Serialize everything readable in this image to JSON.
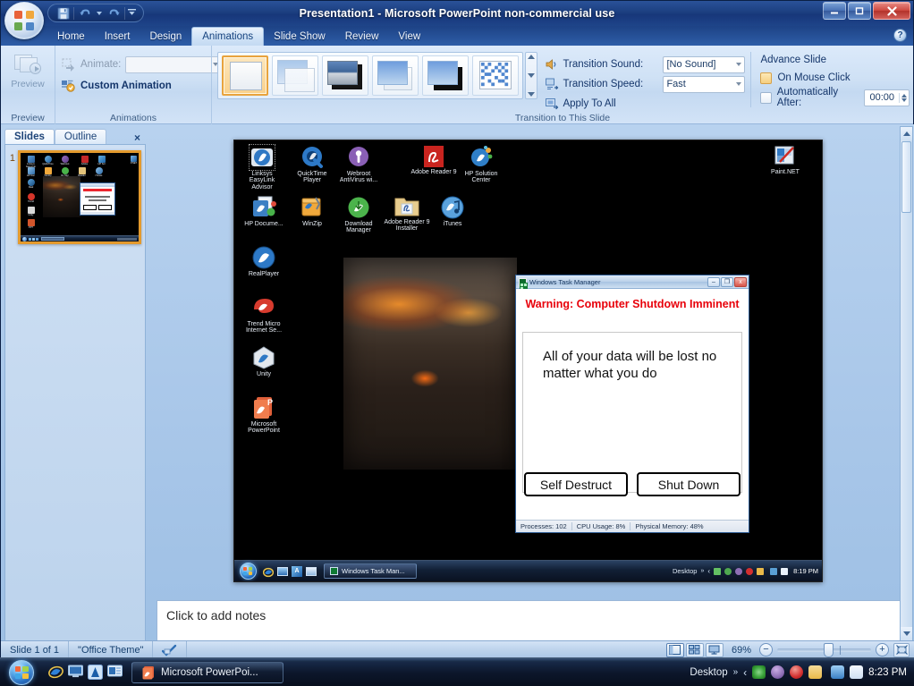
{
  "window": {
    "title": "Presentation1 - Microsoft PowerPoint non-commercial use",
    "minimize_label": "–",
    "restore_label": "❐",
    "close_label": "✕",
    "help_label": "?"
  },
  "quick_access": [
    {
      "name": "save-icon",
      "label": "Save"
    },
    {
      "name": "undo-icon",
      "label": "Undo"
    },
    {
      "name": "undo-dropdown-icon",
      "label": "Undo options"
    },
    {
      "name": "redo-icon",
      "label": "Redo"
    },
    {
      "name": "customize-qat-icon",
      "label": "Customize Quick Access Toolbar"
    }
  ],
  "ribbon": {
    "tabs": [
      {
        "label": "Home",
        "active": false
      },
      {
        "label": "Insert",
        "active": false
      },
      {
        "label": "Design",
        "active": false
      },
      {
        "label": "Animations",
        "active": true
      },
      {
        "label": "Slide Show",
        "active": false
      },
      {
        "label": "Review",
        "active": false
      },
      {
        "label": "View",
        "active": false
      }
    ],
    "groups": {
      "preview": {
        "title": "Preview",
        "button_label": "Preview"
      },
      "animations": {
        "title": "Animations",
        "animate_label": "Animate:",
        "animate_value": "",
        "custom_animation_label": "Custom Animation"
      },
      "transition": {
        "title": "Transition to This Slide",
        "thumbnails": [
          {
            "name": "no-transition",
            "selected": true
          },
          {
            "name": "blinds-fade-smoothly",
            "selected": false
          },
          {
            "name": "cut-through-black",
            "selected": false
          },
          {
            "name": "fade-smoothly",
            "selected": false
          },
          {
            "name": "fade-through-black",
            "selected": false
          },
          {
            "name": "dissolve",
            "selected": false
          }
        ],
        "transition_sound_label": "Transition Sound:",
        "transition_sound_value": "[No Sound]",
        "transition_speed_label": "Transition Speed:",
        "transition_speed_value": "Fast",
        "apply_to_all_label": "Apply To All",
        "advance_slide_label": "Advance Slide",
        "on_mouse_click_label": "On Mouse Click",
        "on_mouse_click_checked": true,
        "automatically_after_label": "Automatically After:",
        "automatically_after_checked": false,
        "automatically_after_value": "00:00"
      }
    }
  },
  "slides_pane": {
    "tabs": [
      {
        "label": "Slides",
        "active": true
      },
      {
        "label": "Outline",
        "active": false
      }
    ],
    "close_label": "×",
    "slides": [
      {
        "number": "1"
      }
    ]
  },
  "notes": {
    "placeholder": "Click to add notes"
  },
  "slide_content": {
    "desktop_icons_left": [
      {
        "label": "Linksys EasyLink Advisor",
        "icon": "linksys-easylink-advisor-icon",
        "selected": true
      },
      {
        "label": "QuickTime Player",
        "icon": "quicktime-player-icon",
        "selected": false
      },
      {
        "label": "Webroot AntiVirus wi...",
        "icon": "webroot-antivirus-icon",
        "selected": false
      },
      {
        "label": "Adobe Reader 9",
        "icon": "adobe-reader-9-icon",
        "selected": false
      },
      {
        "label": "HP Solution Center",
        "icon": "hp-solution-center-icon",
        "selected": false
      },
      {
        "label": "HP Docume...",
        "icon": "hp-documentation-icon",
        "selected": false
      },
      {
        "label": "WinZip",
        "icon": "winzip-icon",
        "selected": false
      },
      {
        "label": "Download Manager",
        "icon": "download-manager-icon",
        "selected": false
      },
      {
        "label": "Adobe Reader 9 Installer",
        "icon": "adobe-reader-9-installer-icon",
        "selected": false
      },
      {
        "label": "iTunes",
        "icon": "itunes-icon",
        "selected": false
      },
      {
        "label": "RealPlayer",
        "icon": "realplayer-icon",
        "selected": false
      },
      {
        "label": "Trend Micro Internet Se...",
        "icon": "trend-micro-icon",
        "selected": false
      },
      {
        "label": "Unity",
        "icon": "unity-icon",
        "selected": false
      },
      {
        "label": "Microsoft PowerPoint",
        "icon": "microsoft-powerpoint-icon",
        "selected": false
      }
    ],
    "desktop_icon_right": {
      "label": "Paint.NET",
      "icon": "paint-net-icon"
    },
    "task_manager": {
      "title": "Windows Task Manager",
      "minimize_label": "–",
      "maximize_label": "❐",
      "close_label": "x",
      "warning": "Warning: Computer Shutdown Imminent",
      "message": "All of your data will be lost no matter what you do",
      "buttons": [
        {
          "label": "Self Destruct",
          "name": "self-destruct-button"
        },
        {
          "label": "Shut Down",
          "name": "shut-down-button"
        }
      ],
      "status": [
        "Processes: 102",
        "CPU Usage: 8%",
        "Physical Memory: 48%"
      ]
    },
    "inner_taskbar": {
      "task_label": "Windows Task Man...",
      "desktop_label": "Desktop",
      "clock": "8:19 PM"
    }
  },
  "status_bar": {
    "slide_label": "Slide 1 of 1",
    "theme_label": "\"Office Theme\"",
    "spellcheck_icon": "spellcheck-icon",
    "zoom_level": "69%",
    "zoom_out_label": "−",
    "zoom_in_label": "+",
    "views": [
      {
        "name": "normal-view-button",
        "active": true
      },
      {
        "name": "slide-sorter-view-button",
        "active": false
      },
      {
        "name": "slide-show-view-button",
        "active": false
      }
    ],
    "fit_slide_label": "Fit slide to current window"
  },
  "taskbar": {
    "start_label": "Start",
    "quick_launch": [
      {
        "name": "internet-explorer-icon",
        "label": "Internet Explorer"
      },
      {
        "name": "show-desktop-icon",
        "label": "Show Desktop"
      },
      {
        "name": "avg-icon",
        "label": "AVG"
      },
      {
        "name": "media-icon",
        "label": "Windows Media"
      }
    ],
    "task_label": "Microsoft PowerPoi...",
    "desktop_label": "Desktop",
    "chevron_label": "»",
    "arrow_label": "‹",
    "tray": [
      {
        "name": "spiral-tray-icon",
        "color": "#4caf50"
      },
      {
        "name": "user-tray-icon",
        "color": "#8e6fb5"
      },
      {
        "name": "avg-tray-icon",
        "color": "#d32f2f"
      },
      {
        "name": "message-tray-icon",
        "color": "#e9b949"
      },
      {
        "name": "network-tray-icon",
        "color": "#5a9fd4"
      },
      {
        "name": "volume-tray-icon",
        "color": "#eaf2fb"
      }
    ],
    "clock": "8:23 PM"
  },
  "colors": {
    "accent": "#1d4285",
    "selected_gallery": "#e8a33d",
    "warning_red": "#e8000a",
    "slide_border": "#e39a2d"
  }
}
